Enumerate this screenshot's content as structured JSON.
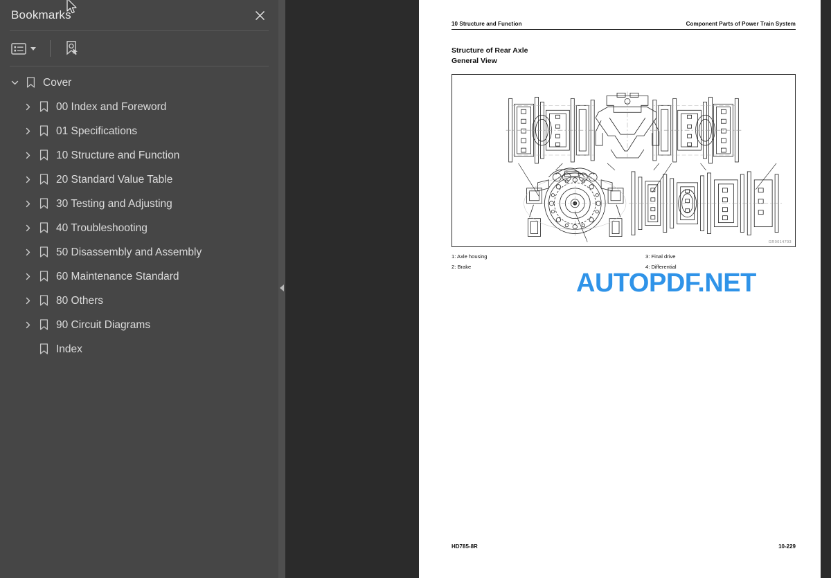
{
  "panel": {
    "title": "Bookmarks",
    "close_label": "×",
    "toolbar": {
      "options_icon": "list-options-icon",
      "options_label": "Bookmark list options",
      "dropdown_icon": "chevron-down-icon",
      "add_bookmark_icon": "bookmark-pointer-icon",
      "add_bookmark_label": "Select/Add bookmark"
    },
    "tree": [
      {
        "label": "Cover",
        "level": 1,
        "expanded": true,
        "has_children": true,
        "icon": "bookmark-icon"
      },
      {
        "label": "00 Index and Foreword",
        "level": 2,
        "expanded": false,
        "has_children": true,
        "icon": "bookmark-icon"
      },
      {
        "label": "01 Specifications",
        "level": 2,
        "expanded": false,
        "has_children": true,
        "icon": "bookmark-icon"
      },
      {
        "label": "10 Structure and Function",
        "level": 2,
        "expanded": false,
        "has_children": true,
        "icon": "bookmark-icon"
      },
      {
        "label": "20 Standard Value Table",
        "level": 2,
        "expanded": false,
        "has_children": true,
        "icon": "bookmark-icon"
      },
      {
        "label": "30 Testing and Adjusting",
        "level": 2,
        "expanded": false,
        "has_children": true,
        "icon": "bookmark-icon"
      },
      {
        "label": "40 Troubleshooting",
        "level": 2,
        "expanded": false,
        "has_children": true,
        "icon": "bookmark-icon"
      },
      {
        "label": "50 Disassembly and Assembly",
        "level": 2,
        "expanded": false,
        "has_children": true,
        "icon": "bookmark-icon"
      },
      {
        "label": "60 Maintenance Standard",
        "level": 2,
        "expanded": false,
        "has_children": true,
        "icon": "bookmark-icon"
      },
      {
        "label": "80 Others",
        "level": 2,
        "expanded": false,
        "has_children": true,
        "icon": "bookmark-icon"
      },
      {
        "label": "90 Circuit Diagrams",
        "level": 2,
        "expanded": false,
        "has_children": true,
        "icon": "bookmark-icon"
      },
      {
        "label": "Index",
        "level": 2,
        "expanded": false,
        "has_children": false,
        "icon": "bookmark-icon"
      }
    ]
  },
  "splitter": {
    "collapse_icon": "collapse-left-arrow-icon"
  },
  "document": {
    "header_left": "10 Structure and Function",
    "header_right": "Component Parts of Power Train System",
    "title_line1": "Structure of Rear Axle",
    "title_line2": "General View",
    "figure_id": "GR0014793",
    "legend": [
      {
        "key": "1:",
        "text": "1: Axle housing"
      },
      {
        "key": "3:",
        "text": "3: Final drive"
      },
      {
        "key": "2:",
        "text": "2: Brake"
      },
      {
        "key": "4:",
        "text": "4: Differential"
      }
    ],
    "footer_left": "HD785-8R",
    "footer_right": "10-229"
  },
  "watermark": {
    "part1": "AUTOPDF",
    "dot": ".",
    "part2": "NET",
    "color_primary": "#2f93e8"
  },
  "colors": {
    "panel_bg": "#464646",
    "viewer_bg": "#2b2b2b",
    "splitter": "#4f4f4f",
    "text": "#dcdcdc"
  }
}
